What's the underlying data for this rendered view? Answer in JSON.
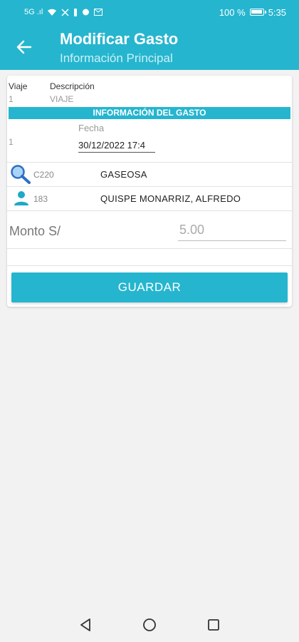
{
  "status_bar": {
    "left_text": "5G .ıl",
    "battery_percent_text": "100 %",
    "battery_level": 1.0,
    "time": "5:35"
  },
  "app_bar": {
    "title": "Modificar Gasto",
    "subtitle": "Información Principal",
    "back_icon": "arrow-left-icon",
    "color": "#26b5cf"
  },
  "trip": {
    "viaje_label": "Viaje",
    "viaje_value": "1",
    "descripcion_label": "Descripción",
    "descripcion_value": "VIAJE"
  },
  "expense_section": {
    "header": "INFORMACIÓN DEL GASTO",
    "item_number": "1",
    "fecha_label": "Fecha",
    "fecha_value": "30/12/2022 17:4"
  },
  "concept": {
    "icon": "search-icon",
    "code": "C220",
    "description": "GASEOSA"
  },
  "person": {
    "icon": "person-icon",
    "code": "183",
    "name": "QUISPE MONARRIZ, ALFREDO"
  },
  "amount": {
    "label": "Monto S/",
    "placeholder": "5.00"
  },
  "actions": {
    "save_label": "GUARDAR"
  },
  "nav_bar": {
    "back_icon": "triangle-back-icon",
    "home_icon": "circle-home-icon",
    "recents_icon": "square-recents-icon"
  }
}
